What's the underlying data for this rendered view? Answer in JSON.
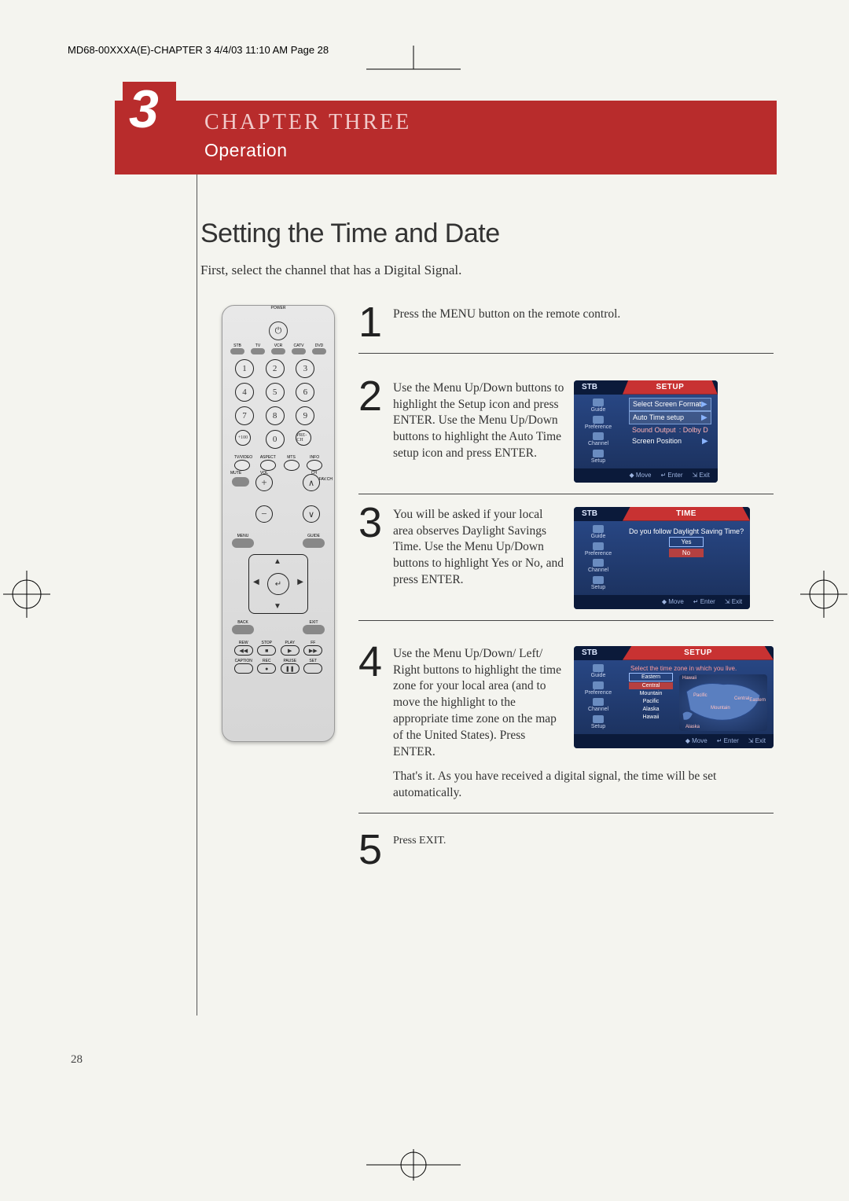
{
  "header_line": "MD68-00XXXA(E)-CHAPTER 3   4/4/03  11:10 AM  Page 28",
  "chapter": {
    "number": "3",
    "title": "CHAPTER THREE",
    "subtitle": "Operation"
  },
  "section_title": "Setting the Time and Date",
  "intro": "First, select the channel that has a Digital Signal.",
  "steps": {
    "s1": {
      "num": "1",
      "text": "Press the MENU button on the remote control."
    },
    "s2": {
      "num": "2",
      "text": "Use the Menu Up/Down buttons to highlight the Setup icon and press ENTER. Use the Menu Up/Down buttons to highlight the Auto Time setup icon and press ENTER."
    },
    "s3": {
      "num": "3",
      "text": "You will be asked if your local area observes Daylight Savings Time. Use the Menu Up/Down buttons to highlight Yes or No, and press ENTER."
    },
    "s4": {
      "num": "4",
      "text_a": "Use the Menu Up/Down/ Left/ Right buttons to highlight the time zone for your local area (and to move the highlight to the appropriate time zone on the map of the United States). Press ENTER.",
      "text_b": "That's it. As you have received a digital signal, the time will be set automatically."
    },
    "s5": {
      "num": "5",
      "text": "Press EXIT."
    }
  },
  "osd": {
    "stb": "STB",
    "setup": "SETUP",
    "time": "TIME",
    "sidebar": {
      "guide": "Guide",
      "pref": "Preference",
      "channel": "Channel",
      "setup": "Setup"
    },
    "footer": {
      "move": "◆ Move",
      "enter": "↵ Enter",
      "exit": "⇲ Exit"
    },
    "panel1": {
      "row1": "Select Screen Format",
      "row2": "Auto Time setup",
      "row3a": "Sound Output",
      "row3b": ": Dolby D",
      "row4": "Screen Position"
    },
    "panel2": {
      "question": "Do you follow Daylight Saving Time?",
      "yes": "Yes",
      "no": "No"
    },
    "panel3": {
      "prompt": "Select the time zone in which you live.",
      "tz": [
        "Eastern",
        "Central",
        "Mountain",
        "Pacific",
        "Alaska",
        "Hawaii"
      ],
      "map_labels": [
        "Hawaii",
        "Pacific",
        "Mountain",
        "Central",
        "Eastern",
        "Alaska"
      ]
    }
  },
  "remote": {
    "power": "POWER",
    "devices": [
      "STB",
      "TV",
      "VCR",
      "CATV",
      "DVD"
    ],
    "nums": [
      "1",
      "2",
      "3",
      "4",
      "5",
      "6",
      "7",
      "8",
      "9"
    ],
    "plus100": "+100",
    "zero": "0",
    "prech": "PRE-CH",
    "belownums": [
      "TV/VIDEO",
      "ASPECT",
      "MTS",
      "INFO"
    ],
    "mute": "MUTE",
    "favch": "FAV.CH",
    "vol": "VOL",
    "ch": "CH",
    "menu": "MENU",
    "guide": "GUIDE",
    "back": "BACK",
    "exit": "EXIT",
    "trans1": [
      "REW",
      "STOP",
      "PLAY",
      "FF"
    ],
    "trans2": [
      "CAPTION",
      "REC",
      "PAUSE",
      "SET"
    ]
  },
  "page_num": "28"
}
